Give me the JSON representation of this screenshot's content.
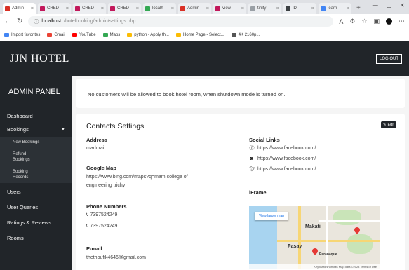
{
  "browser": {
    "tabs": [
      {
        "title": "Admin",
        "color": "#d93025",
        "active": true
      },
      {
        "title": "CRED",
        "color": "#c2185b"
      },
      {
        "title": "CRED",
        "color": "#c2185b"
      },
      {
        "title": "CRED",
        "color": "#c2185b"
      },
      {
        "title": "localh",
        "color": "#34a853"
      },
      {
        "title": "Admin",
        "color": "#d93025"
      },
      {
        "title": "view",
        "color": "#c2185b"
      },
      {
        "title": "tinify",
        "color": "#9aa0a6"
      },
      {
        "title": "ID",
        "color": "#3c4043"
      },
      {
        "title": "learn",
        "color": "#4285f4"
      }
    ],
    "new_tab_label": "+",
    "url_host": "localhost",
    "url_path": "/hotelbooking/admin/settings.php",
    "bookmarks": [
      {
        "label": "Import favorites",
        "color": "#4285f4"
      },
      {
        "label": "Gmail",
        "color": "#ea4335"
      },
      {
        "label": "YouTube",
        "color": "#ff0000"
      },
      {
        "label": "Maps",
        "color": "#34a853"
      },
      {
        "label": "python - Apply th...",
        "color": "#fbbc04"
      },
      {
        "label": "Home Page - Select...",
        "color": "#fbbc04"
      },
      {
        "label": "4K 2160p...",
        "color": "#555555"
      }
    ]
  },
  "header": {
    "brand": "JJN HOTEL",
    "logout_label": "LOG OUT"
  },
  "sidebar": {
    "title": "ADMIN PANEL",
    "items": [
      "Dashboard",
      "Bookings"
    ],
    "booking_submenu": [
      [
        "New Bookings"
      ],
      [
        "Refund",
        "Bookings"
      ],
      [
        "Booking",
        "Records"
      ]
    ],
    "items_after": [
      "Users",
      "User Queries",
      "Ratings & Reviews",
      "Rooms"
    ]
  },
  "notice_text": "No customers will be allowed to book hotel room, when shutdown mode is turned on.",
  "contacts": {
    "title": "Contacts Settings",
    "edit_label": "Edit",
    "address_label": "Address",
    "address_value": "madurai",
    "map_label": "Google Map",
    "map_value_line1": "https://www.bing.com/maps?q=mam college of",
    "map_value_line2": "engineering trichy",
    "phone_label": "Phone Numbers",
    "phones": [
      "7397524249",
      "7397524249"
    ],
    "email_label": "E-mail",
    "email_value": "thethoufik4646@gmail.com",
    "social_label": "Social Links",
    "socials": [
      {
        "icon": "facebook-icon",
        "url": "https://www.facebook.com/"
      },
      {
        "icon": "instagram-icon",
        "url": "https://www.facebook.com/"
      },
      {
        "icon": "twitter-icon",
        "url": "https://www.facebook.com/"
      }
    ],
    "iframe_label": "iFrame",
    "iframe": {
      "view_larger_label": "View larger map",
      "places": [
        "Makati",
        "Pasay",
        "Paranaque"
      ],
      "footer_text": "Keyboard shortcuts  Map data ©2023  Terms of Use"
    }
  }
}
